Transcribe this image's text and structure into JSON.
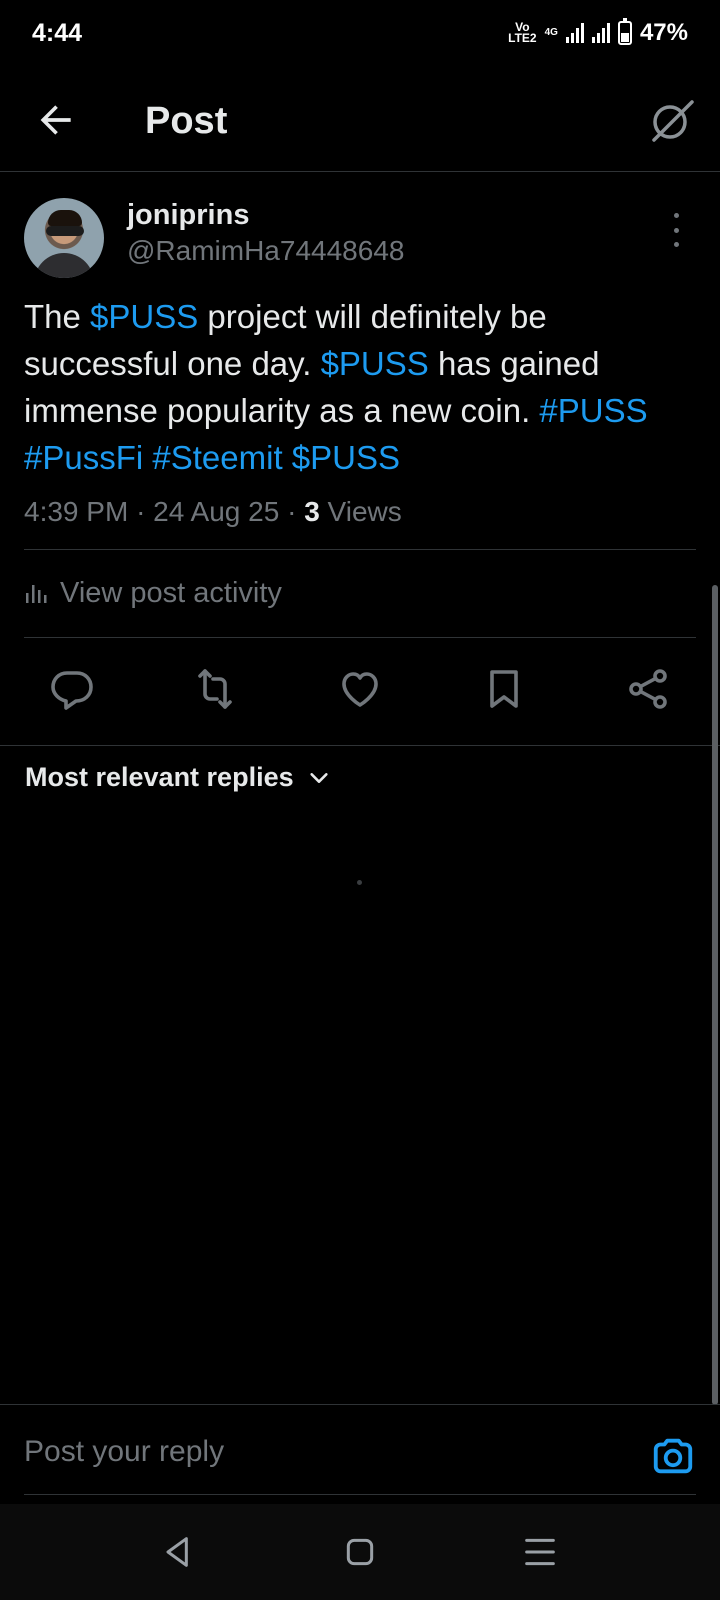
{
  "status_bar": {
    "time": "4:44",
    "volte_top": "Vo",
    "volte_bottom": "LTE2",
    "network": "4G",
    "battery": "47%"
  },
  "header": {
    "title": "Post",
    "back_icon": "arrow-left-icon",
    "right_icon": "grok-icon"
  },
  "post": {
    "display_name": "joniprins",
    "handle": "@RamimHa74448648",
    "text_segments": [
      {
        "text": "The ",
        "link": false
      },
      {
        "text": "$PUSS",
        "link": true
      },
      {
        "text": " project will definitely be successful one day. ",
        "link": false
      },
      {
        "text": "$PUSS",
        "link": true
      },
      {
        "text": " has gained immense popularity as a new coin. ",
        "link": false
      },
      {
        "text": "#PUSS",
        "link": true
      },
      {
        "text": " ",
        "link": false
      },
      {
        "text": "#PussFi",
        "link": true
      },
      {
        "text": " ",
        "link": false
      },
      {
        "text": "#Steemit",
        "link": true
      },
      {
        "text": " ",
        "link": false
      },
      {
        "text": "$PUSS",
        "link": true
      }
    ],
    "time": "4:39 PM",
    "date": "24 Aug 25",
    "views_count": "3",
    "views_label": "Views",
    "separator": "·"
  },
  "activity": {
    "label": "View post activity"
  },
  "actions": [
    {
      "icon": "reply-icon"
    },
    {
      "icon": "repost-icon"
    },
    {
      "icon": "like-icon"
    },
    {
      "icon": "bookmark-icon"
    },
    {
      "icon": "share-icon"
    }
  ],
  "replies": {
    "sort_label": "Most relevant replies"
  },
  "composer": {
    "placeholder": "Post your reply"
  },
  "colors": {
    "accent": "#1d9bf0",
    "background": "#000000",
    "text_primary": "#e7e9ea",
    "text_secondary": "#71767b",
    "divider": "#2f3336"
  }
}
